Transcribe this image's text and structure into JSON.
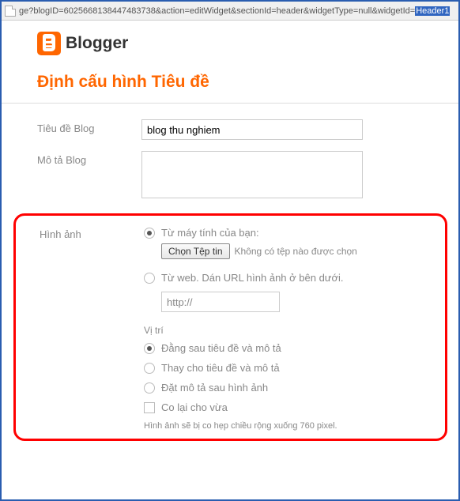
{
  "addressBar": {
    "urlPrefix": "ge?blogID=6025668138447483738&action=editWidget&sectionId=header&widgetType=null&widgetId=",
    "urlSelected": "Header1"
  },
  "brand": {
    "name": "Blogger"
  },
  "page": {
    "title": "Định cấu hình Tiêu đề"
  },
  "form": {
    "blogTitle": {
      "label": "Tiêu đề Blog",
      "value": "blog thu nghiem"
    },
    "blogDesc": {
      "label": "Mô tả Blog",
      "value": ""
    }
  },
  "image": {
    "label": "Hình ảnh",
    "fromComputer": {
      "text": "Từ máy tính của bạn:",
      "button": "Chọn Tệp tin",
      "status": "Không có tệp nào được chọn"
    },
    "fromWeb": {
      "text": "Từ web. Dán URL hình ảnh ở bên dưới.",
      "value": "http://"
    },
    "position": {
      "label": "Vị trí",
      "opt1": "Đằng sau tiêu đề và mô tả",
      "opt2": "Thay cho tiêu đề và mô tả",
      "opt3": "Đặt mô tả sau hình ảnh",
      "shrink": "Co lại cho vừa"
    },
    "note": "Hình ảnh sẽ bị co hẹp chiều rộng xuống 760 pixel."
  }
}
